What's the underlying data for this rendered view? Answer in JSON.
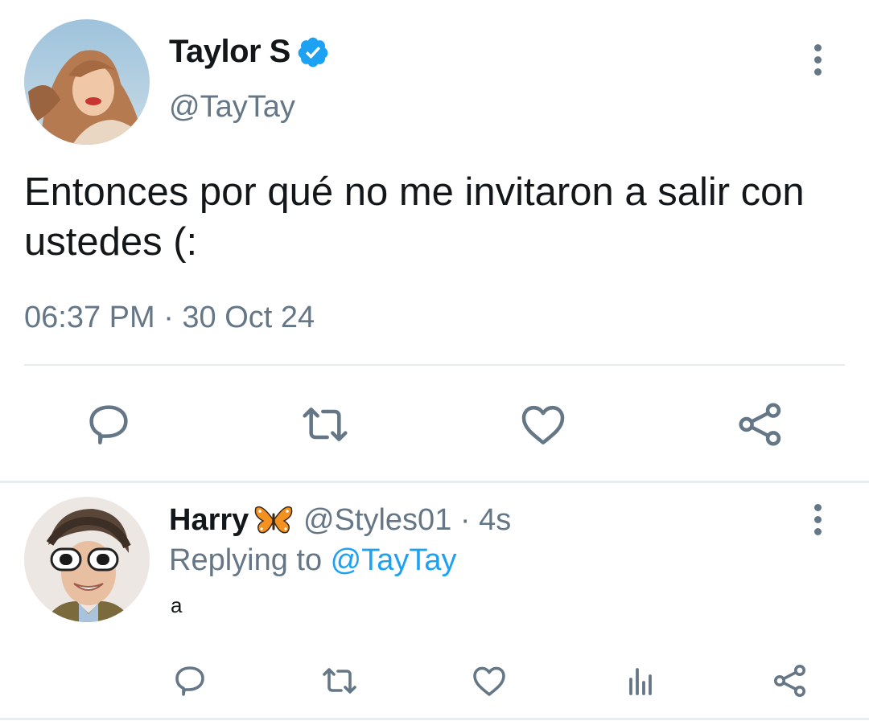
{
  "tweet": {
    "author_name": "Taylor S",
    "author_handle": "@TayTay",
    "text": "Entonces por qué no me invitaron a salir con ustedes (:",
    "timestamp": "06:37 PM · 30 Oct 24",
    "verified": true,
    "actions": [
      "reply-icon",
      "retweet-icon",
      "like-icon",
      "share-icon"
    ]
  },
  "reply": {
    "author_name": "Harry",
    "author_emoji": "butterfly-emoji",
    "handle_time": "@Styles01 · 4s",
    "replying_prefix": "Replying to ",
    "replying_handle": "@TayTay",
    "text": "a",
    "actions": [
      "reply-icon",
      "retweet-icon",
      "like-icon",
      "analytics-icon",
      "share-icon"
    ]
  },
  "colors": {
    "text_primary": "#14171a",
    "text_secondary": "#657786",
    "link": "#1da1f2",
    "divider": "#e6ecf0"
  }
}
